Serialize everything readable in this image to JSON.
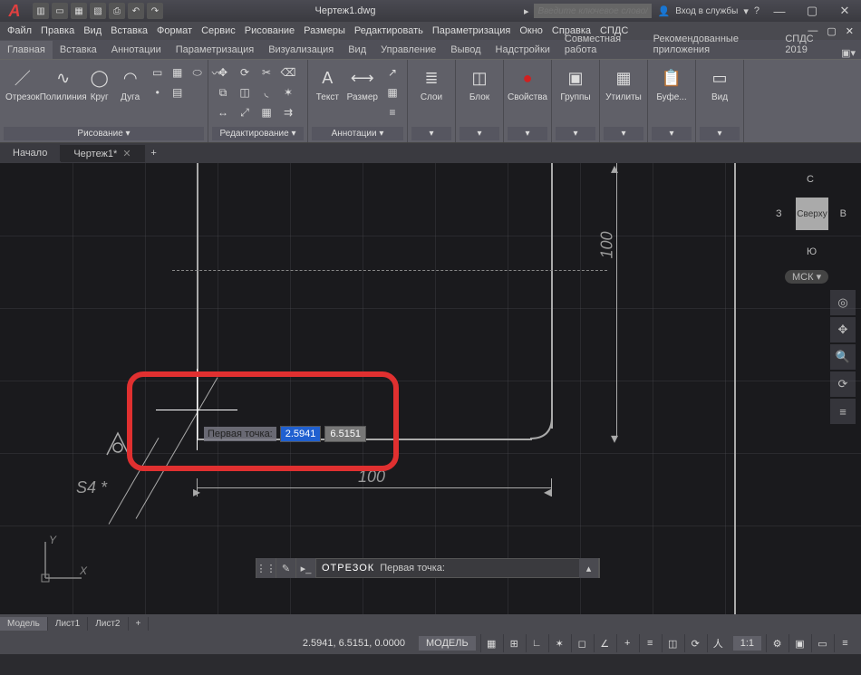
{
  "title": "Чертеж1.dwg",
  "search_placeholder": "Введите ключевое слово/фразу",
  "signin_label": "Вход в службы",
  "menu": {
    "file": "Файл",
    "edit": "Правка",
    "view": "Вид",
    "insert": "Вставка",
    "format": "Формат",
    "service": "Сервис",
    "draw": "Рисование",
    "dim": "Размеры",
    "modify": "Редактировать",
    "param": "Параметризация",
    "window": "Окно",
    "help": "Справка",
    "spds": "СПДС"
  },
  "ribbon_tabs": {
    "main": "Главная",
    "insert": "Вставка",
    "annotate": "Аннотации",
    "param": "Параметризация",
    "view3d": "Визуализация",
    "view": "Вид",
    "manage": "Управление",
    "output": "Вывод",
    "addins": "Надстройки",
    "collab": "Совместная работа",
    "featured": "Рекомендованные приложения",
    "spds": "СПДС 2019"
  },
  "panels": {
    "draw": "Рисование ▾",
    "modify": "Редактирование ▾",
    "annot": "Аннотации ▾",
    "layers": "Слои",
    "block": "Блок",
    "props": "Свойства",
    "groups": "Группы",
    "utils": "Утилиты",
    "clip": "Буфе...",
    "viewp": "Вид"
  },
  "tools": {
    "line": "Отрезок",
    "pline": "Полилиния",
    "circle": "Круг",
    "arc": "Дуга",
    "text": "Текст",
    "dim": "Размер",
    "layers": "Слои",
    "block": "Блок",
    "props": "Свойства",
    "groups": "Группы",
    "utils": "Утилиты",
    "clip": "Буфе...",
    "viewp": "Вид"
  },
  "doc_tabs": {
    "start": "Начало",
    "drawing": "Чертеж1*"
  },
  "dyn": {
    "label": "Первая точка:",
    "x": "2.5941",
    "y": "6.5151"
  },
  "dims": {
    "h": "100",
    "v": "100",
    "roughness": "S4 *"
  },
  "viewcube": {
    "n": "С",
    "s": "Ю",
    "e": "В",
    "w": "З",
    "top": "Сверху",
    "wcs": "МСК ▾"
  },
  "cmd": {
    "name": "ОТРЕЗОК",
    "prompt": "Первая точка:"
  },
  "model_tabs": {
    "model": "Модель",
    "layout1": "Лист1",
    "layout2": "Лист2"
  },
  "status": {
    "coords": "2.5941, 6.5151, 0.0000",
    "model": "МОДЕЛЬ",
    "ratio": "1:1"
  }
}
